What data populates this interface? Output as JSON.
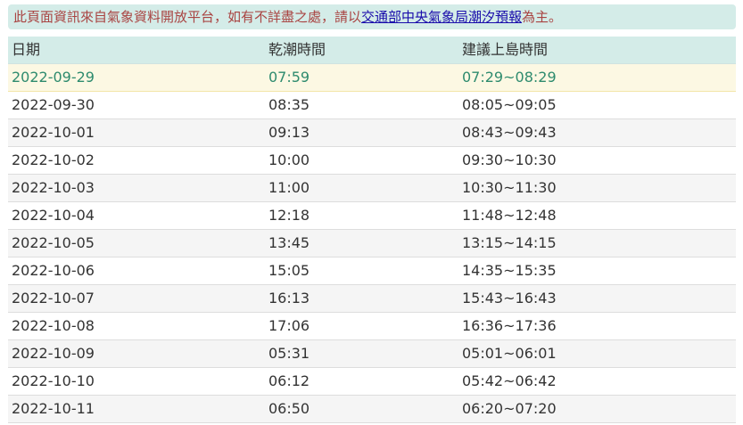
{
  "notice": {
    "prefix": "此頁面資訊來自氣象資料開放平台，如有不詳盡之處，請以",
    "link": "交通部中央氣象局潮汐預報",
    "suffix": "為主。"
  },
  "table": {
    "headers": [
      "日期",
      "乾潮時間",
      "建議上島時間"
    ],
    "rows": [
      {
        "date": "2022-09-29",
        "low_tide": "07:59",
        "suggested": "07:29~08:29"
      },
      {
        "date": "2022-09-30",
        "low_tide": "08:35",
        "suggested": "08:05~09:05"
      },
      {
        "date": "2022-10-01",
        "low_tide": "09:13",
        "suggested": "08:43~09:43"
      },
      {
        "date": "2022-10-02",
        "low_tide": "10:00",
        "suggested": "09:30~10:30"
      },
      {
        "date": "2022-10-03",
        "low_tide": "11:00",
        "suggested": "10:30~11:30"
      },
      {
        "date": "2022-10-04",
        "low_tide": "12:18",
        "suggested": "11:48~12:48"
      },
      {
        "date": "2022-10-05",
        "low_tide": "13:45",
        "suggested": "13:15~14:15"
      },
      {
        "date": "2022-10-06",
        "low_tide": "15:05",
        "suggested": "14:35~15:35"
      },
      {
        "date": "2022-10-07",
        "low_tide": "16:13",
        "suggested": "15:43~16:43"
      },
      {
        "date": "2022-10-08",
        "low_tide": "17:06",
        "suggested": "16:36~17:36"
      },
      {
        "date": "2022-10-09",
        "low_tide": "05:31",
        "suggested": "05:01~06:01"
      },
      {
        "date": "2022-10-10",
        "low_tide": "06:12",
        "suggested": "05:42~06:42"
      },
      {
        "date": "2022-10-11",
        "low_tide": "06:50",
        "suggested": "06:20~07:20"
      }
    ]
  },
  "colors": {
    "header_bg": "#d4ece8",
    "highlight_bg": "#fcf8e3",
    "highlight_text": "#2e8b6e",
    "notice_text": "#a94442",
    "link": "#1a0dab"
  }
}
